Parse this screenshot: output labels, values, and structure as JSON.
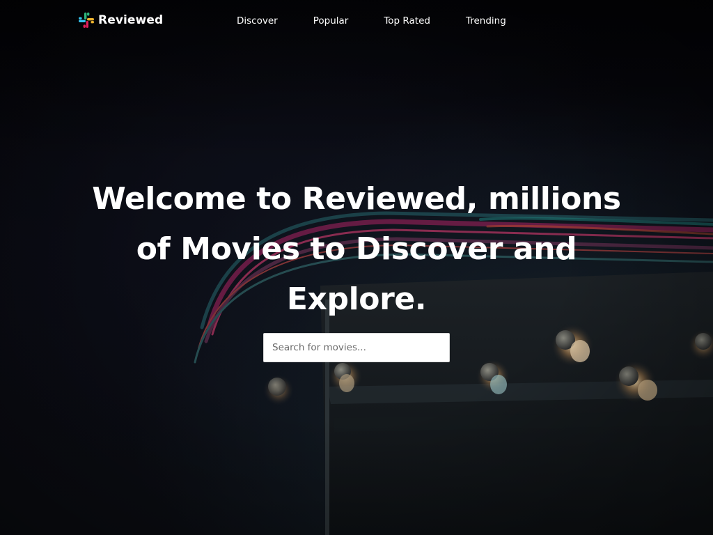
{
  "brand": {
    "name": "Reviewed",
    "logo_icon": "hash-logo-icon",
    "logo_colors": [
      "#36c5f0",
      "#2eb67d",
      "#ecb22e",
      "#e01e5a"
    ]
  },
  "nav": {
    "items": [
      {
        "label": "Discover"
      },
      {
        "label": "Popular"
      },
      {
        "label": "Top Rated"
      },
      {
        "label": "Trending"
      }
    ]
  },
  "hero": {
    "title": "Welcome to Reviewed, millions of Movies to Discover and Explore."
  },
  "search": {
    "placeholder": "Search for movies...",
    "value": ""
  },
  "colors": {
    "background": "#07070b",
    "text": "#ffffff",
    "input_background": "#ffffff"
  }
}
